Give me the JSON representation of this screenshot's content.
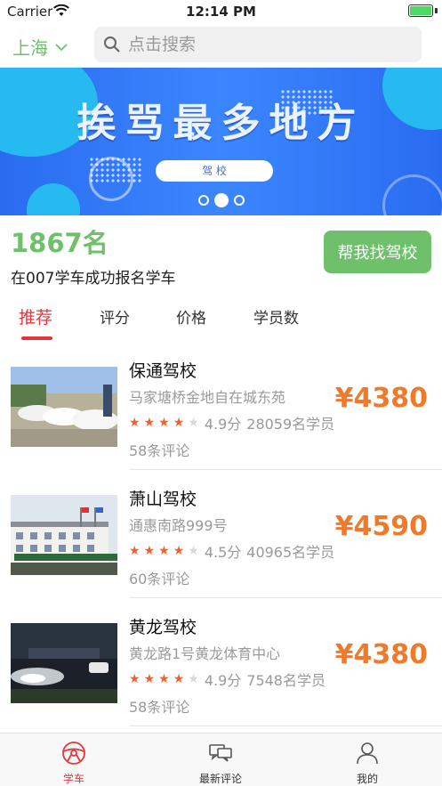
{
  "status_bar": {
    "carrier": "Carrier",
    "time": "12:14 PM"
  },
  "header": {
    "city": "上海",
    "search_placeholder": "点击搜索"
  },
  "banner": {
    "title": "挨骂最多地方",
    "pill_text": "驾 校",
    "page_count": 3,
    "active_page": 2
  },
  "summary": {
    "count": "1867名",
    "subtitle": "在007学车成功报名学车",
    "help_button": "帮我找驾校"
  },
  "sort_tabs": [
    {
      "label": "推荐",
      "active": true
    },
    {
      "label": "评分",
      "active": false
    },
    {
      "label": "价格",
      "active": false
    },
    {
      "label": "学员数",
      "active": false
    }
  ],
  "schools": [
    {
      "name": "保通驾校",
      "address": "马家塘桥金地自在城东苑",
      "stars": 4,
      "score": "4.9分",
      "students": "28059名学员",
      "reviews": "58条评论",
      "price": "¥4380"
    },
    {
      "name": "萧山驾校",
      "address": "通惠南路999号",
      "stars": 4,
      "score": "4.5分",
      "students": "40965名学员",
      "reviews": "60条评论",
      "price": "¥4590"
    },
    {
      "name": "黄龙驾校",
      "address": "黄龙路1号黄龙体育中心",
      "stars": 4,
      "score": "4.9分",
      "students": "7548名学员",
      "reviews": "58条评论",
      "price": "¥4380"
    }
  ],
  "tabbar": [
    {
      "label": "学车",
      "icon": "steering-wheel-icon",
      "active": true
    },
    {
      "label": "最新评论",
      "icon": "chat-bubbles-icon",
      "active": false
    },
    {
      "label": "我的",
      "icon": "person-icon",
      "active": false
    }
  ],
  "colors": {
    "accent_green": "#6ec06b",
    "accent_red": "#e5353d",
    "price_orange": "#f07a2c",
    "star_orange": "#f0622b"
  }
}
